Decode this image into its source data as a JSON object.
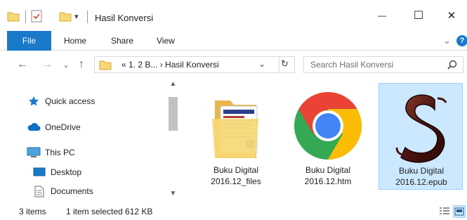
{
  "window": {
    "title": "Hasil Konversi",
    "qa_dropdown_glyph": "▾",
    "minimize_glyph": "—",
    "maximize_glyph": "☐",
    "close_glyph": "✕"
  },
  "ribbon": {
    "tabs": [
      {
        "label": "File",
        "active": true
      },
      {
        "label": "Home"
      },
      {
        "label": "Share"
      },
      {
        "label": "View"
      }
    ],
    "expand_glyph": "⌄",
    "help_glyph": "?"
  },
  "address": {
    "path_text": "« 1. 2 B...  ›  Hasil Konversi",
    "dropdown_glyph": "⌄",
    "refresh_glyph": "↻",
    "back_glyph": "←",
    "forward_glyph": "→",
    "recent_glyph": "⌄",
    "up_glyph": "↑"
  },
  "search": {
    "placeholder": "Search Hasil Konversi"
  },
  "nav_pane": {
    "items": [
      {
        "label": "Quick access",
        "icon": "star-icon"
      },
      {
        "label": "OneDrive",
        "icon": "cloud-icon"
      },
      {
        "label": "This PC",
        "icon": "computer-icon"
      },
      {
        "label": "Desktop",
        "icon": "desktop-icon"
      },
      {
        "label": "Documents",
        "icon": "documents-icon"
      }
    ],
    "scroll_up_glyph": "▲",
    "scroll_down_glyph": "▼"
  },
  "files": [
    {
      "line1": "Buku Digital",
      "line2": "2016.12_files",
      "icon": "folder-icon",
      "selected": false
    },
    {
      "line1": "Buku Digital",
      "line2": "2016.12.htm",
      "icon": "chrome-icon",
      "selected": false
    },
    {
      "line1": "Buku Digital",
      "line2": "2016.12.epub",
      "icon": "epub-s-icon",
      "selected": true
    }
  ],
  "status": {
    "item_count": "3 items",
    "selection": "1 item selected  612 KB"
  },
  "colors": {
    "accent": "#1979ca",
    "selection_bg": "#cce8ff",
    "selection_border": "#99d1ff",
    "folder": "#f8d775"
  }
}
